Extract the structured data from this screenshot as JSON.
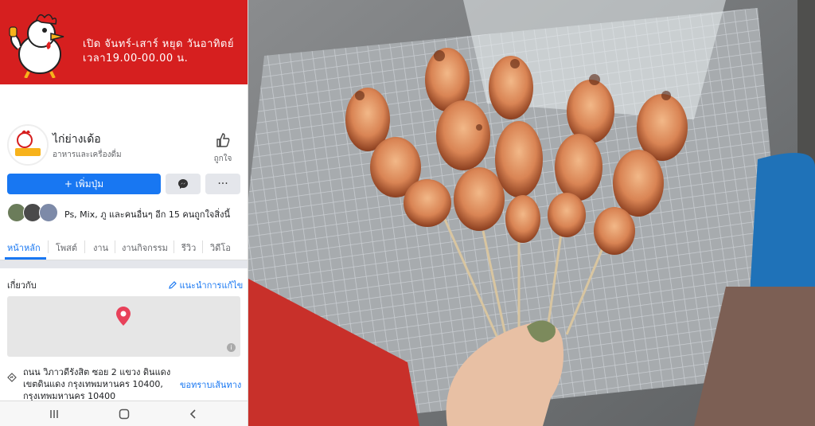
{
  "cover": {
    "hours_line1": "เปิด จันทร์-เสาร์ หยุด วันอาทิตย์",
    "hours_line2": "เวลา19.00-00.00 น."
  },
  "page": {
    "name": "ไก่ย่างเด้อ",
    "category": "อาหารและเครื่องดื่ม",
    "like_label": "ถูกใจ",
    "logo_text": "ไก่ย่างเด้อ"
  },
  "actions": {
    "add_button": "+ เพิ่มปุ่ม",
    "more": "···"
  },
  "friends_text": "Ps, Mix, ภู และคนอื่นๆ อีก 15 คนถูกใจสิ่งนี้",
  "tabs": [
    "หน้าหลัก",
    "โพสต์",
    "งาน",
    "งานกิจกรรม",
    "รีวิว",
    "วิดีโอ"
  ],
  "about": {
    "title": "เกี่ยวกับ",
    "suggest_edit": "แนะนำการแก้ไข",
    "address_line1": "ถนน วิภาวดีรังสิต ซอย 2 แขวง ดินแดง",
    "address_line2": "เขตดินแดง กรุงเทพมหานคร 10400,",
    "address_line3": "กรุงเทพมหานคร 10400",
    "directions": "ขอทราบเส้นทาง"
  },
  "colors": {
    "brand_red": "#d61f1f",
    "fb_blue": "#1877f2"
  },
  "icons": [
    "chicken-mascot-icon",
    "thumbs-up-icon",
    "messenger-icon",
    "map-pin-icon",
    "info-icon",
    "pencil-icon",
    "address-diamond-icon",
    "recent-apps-icon",
    "home-icon",
    "back-icon"
  ]
}
